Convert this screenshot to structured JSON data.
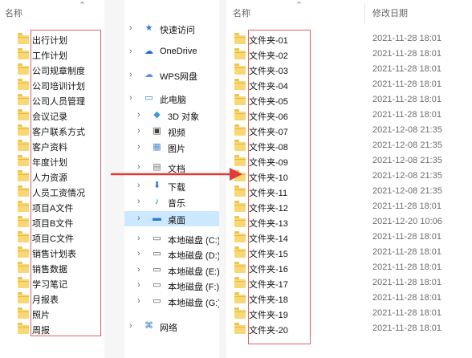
{
  "left_panel": {
    "column_header": "名称",
    "folders": [
      "出行计划",
      "工作计划",
      "公司规章制度",
      "公司培训计划",
      "公司人员管理",
      "会议记录",
      "客户联系方式",
      "客户资料",
      "年度计划",
      "人力资源",
      "人员工资情况",
      "项目A文件",
      "项目B文件",
      "项目C文件",
      "销售计划表",
      "销售数据",
      "学习笔记",
      "月报表",
      "照片",
      "周报"
    ]
  },
  "nav_pane": {
    "items": [
      {
        "label": "快速访问",
        "icon": "star-icon",
        "icon_color": "#2b79d8"
      },
      {
        "label": "OneDrive",
        "icon": "cloud-icon",
        "icon_color": "#1e6fd1"
      },
      {
        "label": "WPS网盘",
        "icon": "cloud-icon",
        "icon_color": "#5b8ee6"
      },
      {
        "label": "此电脑",
        "icon": "pc-icon",
        "icon_color": "#2f7bc5"
      },
      {
        "label": "3D 对象",
        "icon": "cube-icon",
        "icon_color": "#3a9bd7"
      },
      {
        "label": "视频",
        "icon": "video-icon",
        "icon_color": "#444444"
      },
      {
        "label": "图片",
        "icon": "picture-icon",
        "icon_color": "#4a8ad4"
      },
      {
        "label": "文档",
        "icon": "document-icon",
        "icon_color": "#777777"
      },
      {
        "label": "下载",
        "icon": "download-icon",
        "icon_color": "#2f7bc5"
      },
      {
        "label": "音乐",
        "icon": "music-icon",
        "icon_color": "#2f7bc5"
      },
      {
        "label": "桌面",
        "icon": "desktop-icon",
        "icon_color": "#2f7bc5"
      },
      {
        "label": "本地磁盘 (C:)",
        "icon": "drive-icon",
        "icon_color": "#555555"
      },
      {
        "label": "本地磁盘 (D:)",
        "icon": "drive-icon",
        "icon_color": "#555555"
      },
      {
        "label": "本地磁盘 (E:)",
        "icon": "drive-icon",
        "icon_color": "#555555"
      },
      {
        "label": "本地磁盘 (F:)",
        "icon": "drive-icon",
        "icon_color": "#555555"
      },
      {
        "label": "本地磁盘 (G:)",
        "icon": "drive-icon",
        "icon_color": "#555555"
      },
      {
        "label": "网络",
        "icon": "network-icon",
        "icon_color": "#2f7bc5"
      }
    ],
    "selected": "桌面"
  },
  "right_panel": {
    "column_headers": {
      "name": "名称",
      "modified": "修改日期"
    },
    "folders": [
      {
        "name": "文件夹-01",
        "date": "2021-11-28 18:01"
      },
      {
        "name": "文件夹-02",
        "date": "2021-11-28 18:01"
      },
      {
        "name": "文件夹-03",
        "date": "2021-11-28 18:01"
      },
      {
        "name": "文件夹-04",
        "date": "2021-11-28 18:01"
      },
      {
        "name": "文件夹-05",
        "date": "2021-11-28 18:01"
      },
      {
        "name": "文件夹-06",
        "date": "2021-11-28 18:01"
      },
      {
        "name": "文件夹-07",
        "date": "2021-12-08 21:35"
      },
      {
        "name": "文件夹-08",
        "date": "2021-12-08 21:35"
      },
      {
        "name": "文件夹-09",
        "date": "2021-12-08 21:35"
      },
      {
        "name": "文件夹-10",
        "date": "2021-12-08 21:35"
      },
      {
        "name": "文件夹-11",
        "date": "2021-12-08 21:35"
      },
      {
        "name": "文件夹-12",
        "date": "2021-11-28 18:01"
      },
      {
        "name": "文件夹-13",
        "date": "2021-12-20 10:06"
      },
      {
        "name": "文件夹-14",
        "date": "2021-11-28 18:01"
      },
      {
        "name": "文件夹-15",
        "date": "2021-11-28 18:01"
      },
      {
        "name": "文件夹-16",
        "date": "2021-11-28 18:01"
      },
      {
        "name": "文件夹-17",
        "date": "2021-11-28 18:01"
      },
      {
        "name": "文件夹-18",
        "date": "2021-11-28 18:01"
      },
      {
        "name": "文件夹-19",
        "date": "2021-11-28 18:01"
      },
      {
        "name": "文件夹-20",
        "date": "2021-11-28 18:01"
      }
    ]
  },
  "colors": {
    "folder": "#f8d775",
    "highlight_box": "#e06060",
    "arrow": "#e03a3a",
    "selection": "#cce8ff"
  }
}
